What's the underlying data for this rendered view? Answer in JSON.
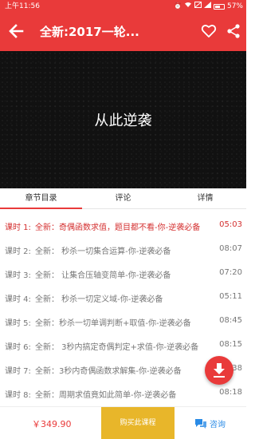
{
  "status_bar": {
    "time": "上午11:56",
    "battery": "57%",
    "battery_level": 0.57
  },
  "app_bar": {
    "title": "全新:2017一轮...",
    "back_icon": "arrow-left-icon",
    "favorite_icon": "heart-outline-icon",
    "share_icon": "share-icon"
  },
  "video": {
    "caption": "从此逆袭"
  },
  "tabs": [
    {
      "label": "章节目录",
      "active": true
    },
    {
      "label": "评论",
      "active": false
    },
    {
      "label": "详情",
      "active": false
    }
  ],
  "lessons": [
    {
      "num": "课时 1:",
      "title": "全新：奇偶函数求值，题目都不看-你-逆袭必备",
      "duration": "05:03",
      "active": true
    },
    {
      "num": "课时 2:",
      "title": "全新： 秒杀一切集合运算-你-逆袭必备",
      "duration": "08:07",
      "active": false
    },
    {
      "num": "课时 3:",
      "title": "全新： 让集合压轴变简单-你-逆袭必备",
      "duration": "07:20",
      "active": false
    },
    {
      "num": "课时 4:",
      "title": "全新： 秒杀一切定义域-你-逆袭必备",
      "duration": "05:11",
      "active": false
    },
    {
      "num": "课时 5:",
      "title": "全新：秒杀一切单调判断+取值-你-逆袭必备",
      "duration": "08:45",
      "active": false
    },
    {
      "num": "课时 6:",
      "title": "全新： 3秒内搞定奇偶判定+求值-你-逆袭必备",
      "duration": "08:15",
      "active": false
    },
    {
      "num": "课时 7:",
      "title": "全新：3秒内奇偶函数求解集-你-逆袭必备",
      "duration": "08:38",
      "active": false
    },
    {
      "num": "课时 8:",
      "title": "全新：周期求值竟如此简单-你-逆袭必备",
      "duration": "08:18",
      "active": false
    }
  ],
  "fab": {
    "icon": "download-icon"
  },
  "bottom_bar": {
    "price": "￥349.90",
    "buy_label": "购买此课程",
    "consult_label": "咨询",
    "consult_icon": "chat-bubble-icon"
  },
  "colors": {
    "primary": "#e93a3a",
    "buy": "#e8b62a",
    "consult": "#2a8be6"
  }
}
